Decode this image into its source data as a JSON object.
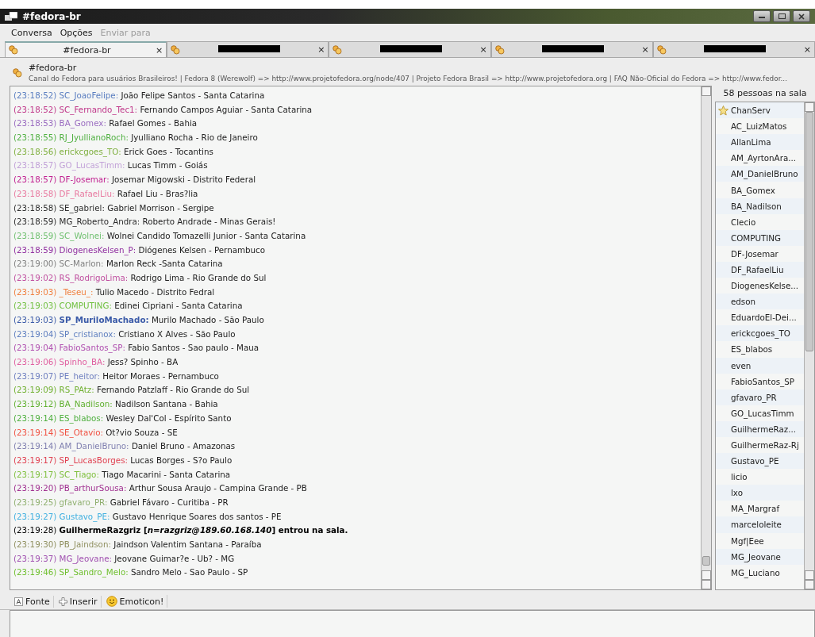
{
  "window": {
    "title": "#fedora-br"
  },
  "menu": [
    {
      "label": "Conversa",
      "disabled": false
    },
    {
      "label": "Opções",
      "disabled": false
    },
    {
      "label": "Enviar para",
      "disabled": true
    }
  ],
  "tabs": [
    {
      "label": "#fedora-br",
      "close": "×",
      "selected": true,
      "redacted": false
    },
    {
      "close": "×",
      "selected": false,
      "redacted": true
    },
    {
      "close": "×",
      "selected": false,
      "redacted": true
    },
    {
      "close": "×",
      "selected": false,
      "redacted": true
    },
    {
      "close": "×",
      "selected": false,
      "redacted": true
    }
  ],
  "topic": {
    "channel": "#fedora-br",
    "text": "Canal do Fedora para usuários Brasileiros! | Fedora 8 (Werewolf) => http://www.projetofedora.org/node/407 | Projeto Fedora Brasil => http://www.projetofedora.org | FAQ Não-Oficial do Fedora => http://www.fedor..."
  },
  "messages": [
    {
      "kind": "message",
      "time": "(23:18:52)",
      "nick": "SC_JoaoFelipe:",
      "text": "João Felipe Santos - Santa Catarina",
      "color": "#5a7ec0"
    },
    {
      "kind": "message",
      "time": "(23:18:52)",
      "nick": "SC_Fernando_Tec1:",
      "text": "Fernando Campos Aguiar - Santa Catarina",
      "color": "#c0388a"
    },
    {
      "kind": "message",
      "time": "(23:18:53)",
      "nick": "BA_Gomex:",
      "text": "Rafael Gomes - Bahia",
      "color": "#9a6cc0"
    },
    {
      "kind": "message",
      "time": "(23:18:55)",
      "nick": "RJ_JyullianoRoch:",
      "text": "Jyulliano Rocha - Rio de Janeiro",
      "color": "#4fb040"
    },
    {
      "kind": "message",
      "time": "(23:18:56)",
      "nick": "erickcgoes_TO:",
      "text": "Erick Goes - Tocantins",
      "color": "#80b040"
    },
    {
      "kind": "message",
      "time": "(23:18:57)",
      "nick": "GO_LucasTimm:",
      "text": "Lucas Timm - Goiás",
      "color": "#c2a2d8"
    },
    {
      "kind": "message",
      "time": "(23:18:57)",
      "nick": "DF-Josemar:",
      "text": "Josemar Migowski - Distrito Federal",
      "color": "#c02090"
    },
    {
      "kind": "message",
      "time": "(23:18:58)",
      "nick": "DF_RafaelLiu:",
      "text": "Rafael Liu - Bras?lia",
      "color": "#e87aa0"
    },
    {
      "kind": "message",
      "time": "(23:18:58)",
      "nick": "SE_gabriel:",
      "text": "Gabriel Morrison - Sergipe",
      "color": "#303030"
    },
    {
      "kind": "message",
      "time": "(23:18:59)",
      "nick": "MG_Roberto_Andra:",
      "text": "Roberto Andrade - Minas Gerais!",
      "color": "#2a2a2a"
    },
    {
      "kind": "message",
      "time": "(23:18:59)",
      "nick": "SC_Wolnei:",
      "text": "Wolnei Candido Tomazelli Junior - Santa Catarina",
      "color": "#70c070"
    },
    {
      "kind": "message",
      "time": "(23:18:59)",
      "nick": "DiogenesKelsen_P:",
      "text": "Diógenes Kelsen - Pernambuco",
      "color": "#9030a0"
    },
    {
      "kind": "message",
      "time": "(23:19:00)",
      "nick": "SC-Marlon:",
      "text": "Marlon Reck -Santa Catarina",
      "color": "#808080"
    },
    {
      "kind": "message",
      "time": "(23:19:02)",
      "nick": "RS_RodrigoLima:",
      "text": "Rodrigo Lima - Rio Grande do Sul",
      "color": "#c050a0"
    },
    {
      "kind": "message",
      "time": "(23:19:03)",
      "nick": "_Teseu_:",
      "text": "Tulio Macedo - Distrito Fedral",
      "color": "#f08040"
    },
    {
      "kind": "message",
      "time": "(23:19:03)",
      "nick": "COMPUTING:",
      "text": "Edinei Cipriani - Santa Catarina",
      "color": "#70c040"
    },
    {
      "kind": "highlight",
      "time": "(23:19:03)",
      "nick": "SP_MuriloMachado:",
      "text": "Murilo Machado - São Paulo",
      "color": "#3a5aa8"
    },
    {
      "kind": "message",
      "time": "(23:19:04)",
      "nick": "SP_cristianox:",
      "text": "Cristiano X Alves - São Paulo",
      "color": "#6080c0"
    },
    {
      "kind": "message",
      "time": "(23:19:04)",
      "nick": "FabioSantos_SP:",
      "text": "Fabio Santos - Sao paulo - Maua",
      "color": "#b050b0"
    },
    {
      "kind": "message",
      "time": "(23:19:06)",
      "nick": "Spinho_BA:",
      "text": "Jess? Spinho - BA",
      "color": "#e060a0"
    },
    {
      "kind": "message",
      "time": "(23:19:07)",
      "nick": "PE_heitor:",
      "text": "Heitor Moraes - Pernambuco",
      "color": "#7080c0"
    },
    {
      "kind": "message",
      "time": "(23:19:09)",
      "nick": "RS_PAtz:",
      "text": "Fernando Patzlaff - Rio Grande do Sul",
      "color": "#70b030"
    },
    {
      "kind": "message",
      "time": "(23:19:12)",
      "nick": "BA_Nadilson:",
      "text": "Nadilson Santana - Bahia",
      "color": "#60b030"
    },
    {
      "kind": "message",
      "time": "(23:19:14)",
      "nick": "ES_blabos:",
      "text": "Wesley Dal'Col - Espírito Santo",
      "color": "#50b040"
    },
    {
      "kind": "message",
      "time": "(23:19:14)",
      "nick": "SE_Otavio:",
      "text": "Ot?vio Souza - SE",
      "color": "#f05040"
    },
    {
      "kind": "message",
      "time": "(23:19:14)",
      "nick": "AM_DanielBruno:",
      "text": "Daniel Bruno - Amazonas",
      "color": "#8080b0"
    },
    {
      "kind": "message",
      "time": "(23:19:17)",
      "nick": "SP_LucasBorges:",
      "text": "Lucas Borges - S?o Paulo",
      "color": "#e04050"
    },
    {
      "kind": "message",
      "time": "(23:19:17)",
      "nick": "SC_Tiago:",
      "text": "Tiago Macarini - Santa Catarina",
      "color": "#80c040"
    },
    {
      "kind": "message",
      "time": "(23:19:20)",
      "nick": "PB_arthurSousa:",
      "text": "Arthur Sousa Araujo - Campina Grande - PB",
      "color": "#a03090"
    },
    {
      "kind": "message",
      "time": "(23:19:25)",
      "nick": "gfavaro_PR:",
      "text": "Gabriel Fávaro - Curitiba - PR",
      "color": "#90b070"
    },
    {
      "kind": "message",
      "time": "(23:19:27)",
      "nick": "Gustavo_PE:",
      "text": "Gustavo Henrique Soares dos santos - PE",
      "color": "#40b0e0"
    },
    {
      "kind": "join",
      "time": "(23:19:28)",
      "text": "GuilhermeRazgriz [*n=razgriz@189.60.168.140*] entrou na sala.",
      "color": "#000000"
    },
    {
      "kind": "message",
      "time": "(23:19:30)",
      "nick": "PB_Jaindson:",
      "text": "Jaindson Valentim Santana - Paraíba",
      "color": "#909060"
    },
    {
      "kind": "message",
      "time": "(23:19:37)",
      "nick": "MG_Jeovane:",
      "text": "Jeovane Guimar?e - Ub? - MG",
      "color": "#a050b0"
    },
    {
      "kind": "message",
      "time": "(23:19:46)",
      "nick": "SP_Sandro_Melo:",
      "text": "Sandro Melo - Sao Paulo - SP",
      "color": "#70c030"
    }
  ],
  "users": {
    "count": "58 pessoas na sala",
    "items": [
      {
        "name": "ChanServ",
        "op": true
      },
      {
        "name": "AC_LuizMatos",
        "op": false
      },
      {
        "name": "AllanLima",
        "op": false
      },
      {
        "name": "AM_AyrtonAra...",
        "op": false
      },
      {
        "name": "AM_DanielBruno",
        "op": false
      },
      {
        "name": "BA_Gomex",
        "op": false
      },
      {
        "name": "BA_Nadilson",
        "op": false
      },
      {
        "name": "Clecio",
        "op": false
      },
      {
        "name": "COMPUTING",
        "op": false
      },
      {
        "name": "DF-Josemar",
        "op": false
      },
      {
        "name": "DF_RafaelLiu",
        "op": false
      },
      {
        "name": "DiogenesKelse...",
        "op": false
      },
      {
        "name": "edson",
        "op": false
      },
      {
        "name": "EduardoEl-Dei...",
        "op": false
      },
      {
        "name": "erickcgoes_TO",
        "op": false
      },
      {
        "name": "ES_blabos",
        "op": false
      },
      {
        "name": "even",
        "op": false
      },
      {
        "name": "FabioSantos_SP",
        "op": false
      },
      {
        "name": "gfavaro_PR",
        "op": false
      },
      {
        "name": "GO_LucasTimm",
        "op": false
      },
      {
        "name": "GuilhermeRaz...",
        "op": false
      },
      {
        "name": "GuilhermeRaz-Rj",
        "op": false
      },
      {
        "name": "Gustavo_PE",
        "op": false
      },
      {
        "name": "licio",
        "op": false
      },
      {
        "name": "lxo",
        "op": false
      },
      {
        "name": "MA_Margraf",
        "op": false
      },
      {
        "name": "marceloleite",
        "op": false
      },
      {
        "name": "Mgf|Eee",
        "op": false
      },
      {
        "name": "MG_Jeovane",
        "op": false
      },
      {
        "name": "MG_Luciano",
        "op": false
      }
    ]
  },
  "toolbar": [
    {
      "kind": "font",
      "label": "Fonte"
    },
    {
      "kind": "insert",
      "label": "Inserir"
    },
    {
      "kind": "emoticon",
      "label": "Emoticon!"
    }
  ]
}
